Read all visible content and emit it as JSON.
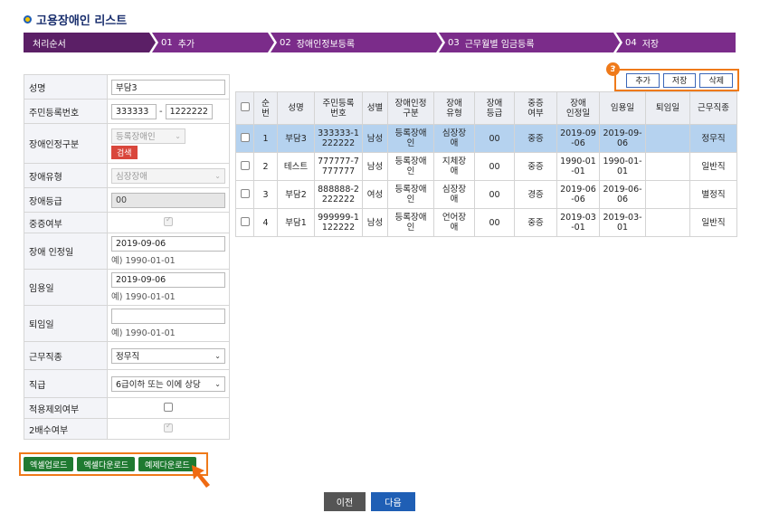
{
  "title": "고용장애인 리스트",
  "steps": [
    {
      "num": "",
      "label": "처리순서"
    },
    {
      "num": "01",
      "label": "추가"
    },
    {
      "num": "02",
      "label": "장애인정보등록"
    },
    {
      "num": "03",
      "label": "근무월별 임금등록"
    },
    {
      "num": "04",
      "label": "저장"
    }
  ],
  "form": {
    "name_label": "성명",
    "name_value": "부담3",
    "rrn_label": "주민등록번호",
    "rrn_front": "333333",
    "rrn_sep": "-",
    "rrn_back": "1222222",
    "cert_type_label": "장애인정구분",
    "cert_type_value": "등록장애인",
    "search_btn": "검색",
    "dis_type_label": "장애유형",
    "dis_type_value": "심장장애",
    "grade_label": "장애등급",
    "grade_value": "00",
    "severe_label": "중증여부",
    "cert_date_label": "장애 인정일",
    "cert_date_value": "2019-09-06",
    "cert_date_hint": "예) 1990-01-01",
    "hire_date_label": "임용일",
    "hire_date_value": "2019-09-06",
    "hire_date_hint": "예) 1990-01-01",
    "resign_label": "퇴임일",
    "resign_value": "",
    "resign_hint": "예) 1990-01-01",
    "job_label": "근무직종",
    "job_value": "정무직",
    "rank_label": "직급",
    "rank_value": "6급이하 또는 이에 상당",
    "exclude_label": "적용제외여부",
    "double_label": "2배수여부"
  },
  "downloads": {
    "excel_up": "엑셀업로드",
    "excel_down": "엑셀다운로드",
    "sample_down": "예제다운로드"
  },
  "actions": {
    "badge": "3",
    "add": "추가",
    "save": "저장",
    "delete": "삭제"
  },
  "table": {
    "headers": [
      "",
      "순번",
      "성명",
      "주민등록번호",
      "성별",
      "장애인정구분",
      "장애유형",
      "장애등급",
      "중증여부",
      "장애인정일",
      "임용일",
      "퇴임일",
      "근무직종"
    ],
    "headers_display": [
      "",
      "순\n번",
      "성명",
      "주민등록\n번호",
      "성별",
      "장애인정\n구분",
      "장애\n유형",
      "장애\n등급",
      "중증\n여부",
      "장애\n인정일",
      "임용일",
      "퇴임일",
      "근무직종"
    ],
    "rows": [
      {
        "no": "1",
        "name": "부담3",
        "rrn": "333333-1\n222222",
        "sex": "남성",
        "cert": "등록장애\n인",
        "type": "심장장\n애",
        "grade": "00",
        "severe": "중증",
        "cert_date": "2019-09\n-06",
        "hire": "2019-09-\n06",
        "resign": "",
        "job": "정무직"
      },
      {
        "no": "2",
        "name": "테스트",
        "rrn": "777777-7\n777777",
        "sex": "남성",
        "cert": "등록장애\n인",
        "type": "지체장\n애",
        "grade": "00",
        "severe": "중증",
        "cert_date": "1990-01\n-01",
        "hire": "1990-01-\n01",
        "resign": "",
        "job": "일반직"
      },
      {
        "no": "3",
        "name": "부담2",
        "rrn": "888888-2\n222222",
        "sex": "여성",
        "cert": "등록장애\n인",
        "type": "심장장\n애",
        "grade": "00",
        "severe": "경증",
        "cert_date": "2019-06\n-06",
        "hire": "2019-06-\n06",
        "resign": "",
        "job": "별정직"
      },
      {
        "no": "4",
        "name": "부담1",
        "rrn": "999999-1\n122222",
        "sex": "남성",
        "cert": "등록장애\n인",
        "type": "언어장\n애",
        "grade": "00",
        "severe": "중증",
        "cert_date": "2019-03\n-01",
        "hire": "2019-03-\n01",
        "resign": "",
        "job": "일반직"
      }
    ]
  },
  "nav": {
    "prev": "이전",
    "next": "다음"
  },
  "colors": {
    "accent": "#ef7a1a",
    "step": "#7b2c8a",
    "selected_row": "#b5d2ef",
    "next_btn": "#1f5fb5"
  }
}
